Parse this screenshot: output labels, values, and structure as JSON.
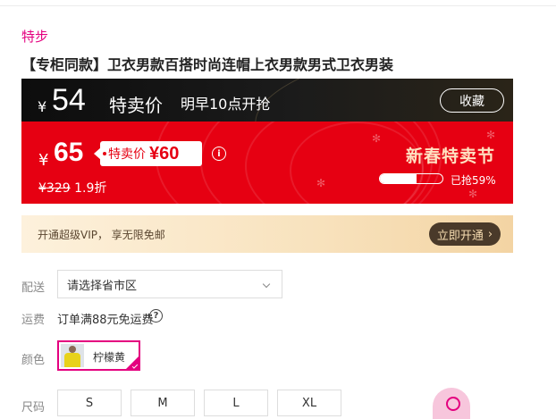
{
  "header": {
    "brand": "特步",
    "product_title": "【专柜同款】卫衣男款百搭时尚连帽上衣男款男式卫衣男装"
  },
  "flash_sale": {
    "currency": "¥",
    "preview_price": "54",
    "preview_label": "特卖价",
    "start_time_text": "明早10点开抢",
    "favorite_label": "收藏"
  },
  "current_sale": {
    "currency": "¥",
    "price": "65",
    "tag_label": "特卖价",
    "tag_price": "¥60",
    "original_price": "¥329",
    "discount": "1.9折",
    "festival_title": "新春特卖节",
    "sold_text": "已抢59%",
    "sold_progress": 0.59
  },
  "vip": {
    "text": "开通超级VIP， 享无限免邮",
    "button_label": "立即开通",
    "button_arrow": "›"
  },
  "options": {
    "delivery_label": "配送",
    "delivery_select_value": "请选择省市区",
    "shipping_label": "运费",
    "shipping_text": "订单满88元免运费",
    "color_label": "颜色",
    "color_selected": "柠檬黄",
    "size_label": "尺码",
    "sizes": [
      "S",
      "M",
      "L",
      "XL"
    ]
  },
  "icons": {
    "info": "info-icon",
    "help": "question-icon",
    "chevron": "chevron-down-icon"
  },
  "colors": {
    "brand_pink": "#e4007f",
    "sale_red": "#e60012",
    "vip_gold": "#f8e2bd"
  }
}
